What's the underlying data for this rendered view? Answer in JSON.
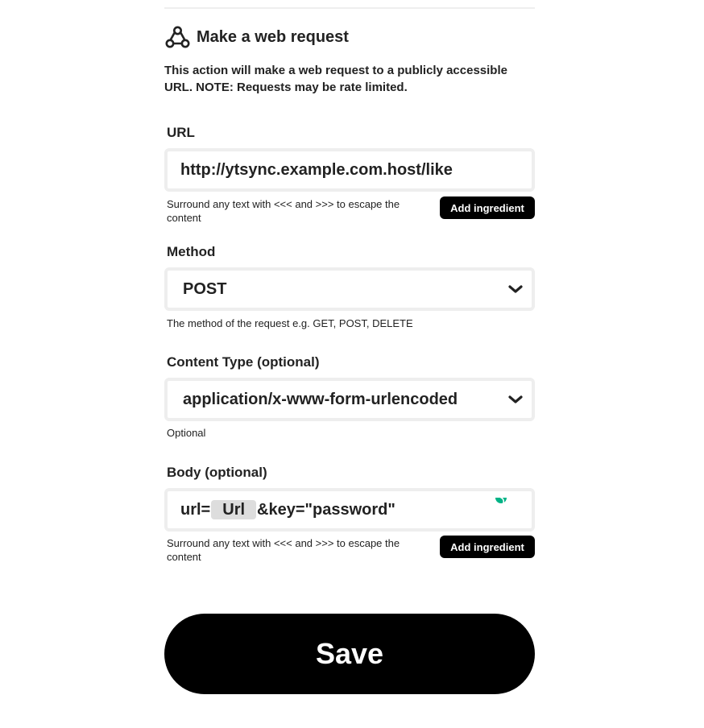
{
  "header": {
    "title": "Make a web request",
    "icon": "webhook-icon",
    "description": "This action will make a web request to a publicly accessible URL. NOTE: Requests may be rate limited."
  },
  "url_field": {
    "label": "URL",
    "value": "http://ytsync.example.com.host/like",
    "helper": "Surround any text with <<< and >>> to escape the content",
    "ingredient_button": "Add ingredient"
  },
  "method_field": {
    "label": "Method",
    "value": "POST",
    "helper": "The method of the request e.g. GET, POST, DELETE"
  },
  "content_type_field": {
    "label": "Content Type (optional)",
    "value": "application/x-www-form-urlencoded",
    "helper": "Optional"
  },
  "body_field": {
    "label": "Body (optional)",
    "prefix": "url=",
    "ingredient_pill": "Url",
    "suffix": "&key=\"password\"",
    "helper": "Surround any text with <<< and >>> to escape the content",
    "ingredient_button": "Add ingredient"
  },
  "save_button": "Save",
  "colors": {
    "field_border": "#eeeeee",
    "button_bg": "#000000",
    "pill_bg": "#dddddd",
    "accent_green": "#00b386"
  }
}
